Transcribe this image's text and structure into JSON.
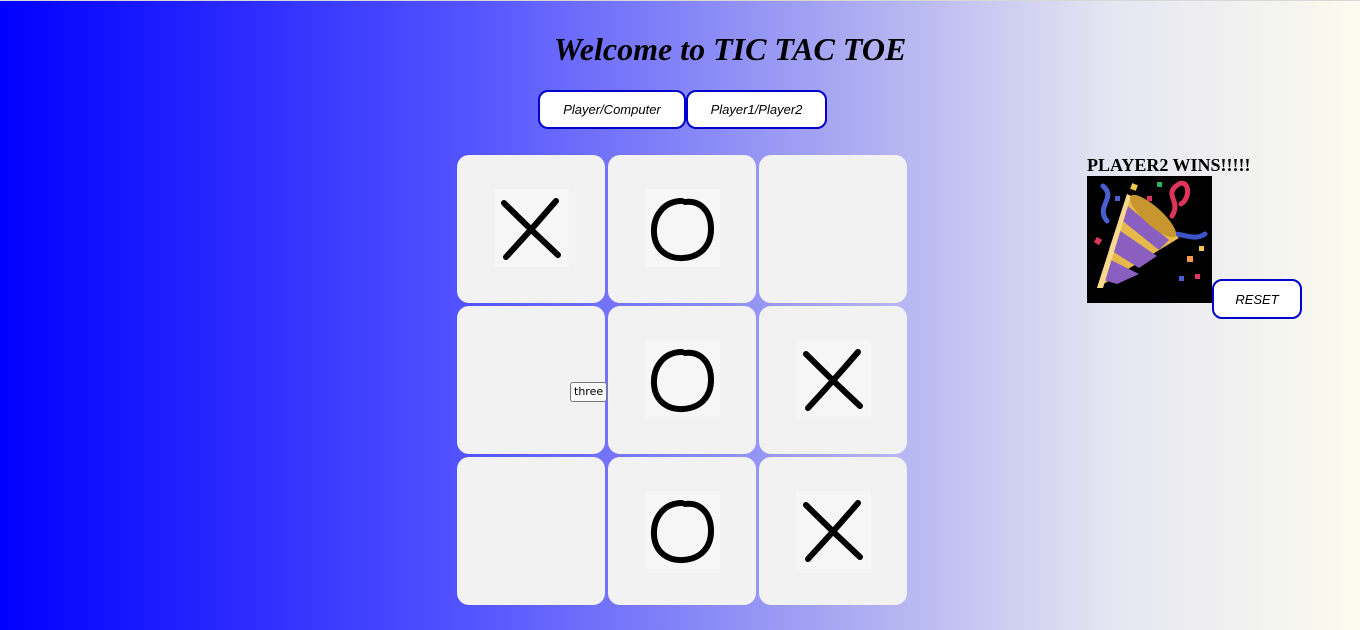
{
  "title": "Welcome to TIC TAC TOE",
  "modes": {
    "player_computer_label": "Player/Computer",
    "player1_player2_label": "Player1/Player2"
  },
  "board": {
    "cells": [
      "X",
      "O",
      "",
      "",
      "O",
      "X",
      "",
      "O",
      "X"
    ]
  },
  "tooltip_text": "three",
  "result": {
    "message": "PLAYER2 WINS!!!!!",
    "image_icon": "party-popper-icon"
  },
  "reset_label": "RESET",
  "colors": {
    "accent_border": "#0000cc",
    "cell_bg": "#f2f2f2",
    "gradient_start": "#0000ff",
    "gradient_end": "#fbfbee"
  }
}
